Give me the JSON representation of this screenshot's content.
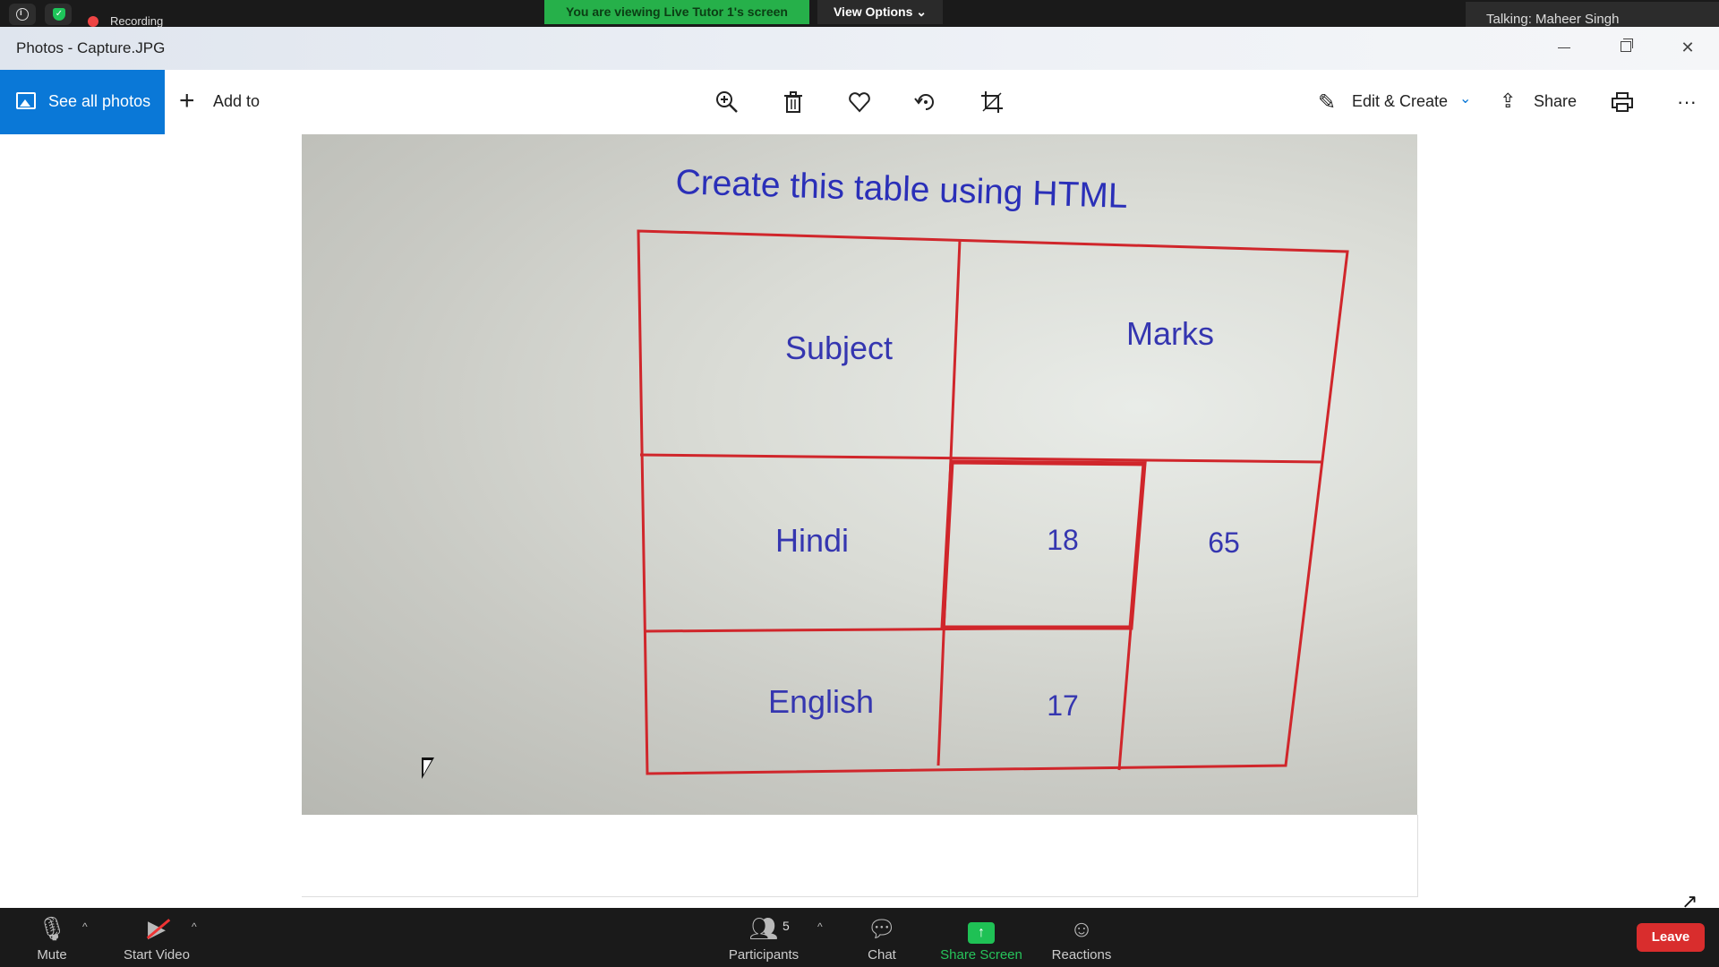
{
  "zoom_top": {
    "recording_label": "Recording",
    "viewing_banner": "You are viewing Live Tutor 1's screen",
    "view_options_label": "View Options ⌄",
    "talking": "Talking: Maheer Singh",
    "colors": {
      "banner": "#26b04a",
      "recording": "#e44444"
    }
  },
  "window": {
    "title": "Photos - Capture.JPG"
  },
  "toolbar": {
    "see_all_photos": "See all photos",
    "add_to": "Add to",
    "edit_create": "Edit & Create",
    "share": "Share",
    "icons": [
      "zoom-in-icon",
      "delete-icon",
      "heart-icon",
      "rotate-icon",
      "crop-icon",
      "print-icon",
      "more-icon"
    ],
    "accent": "#0a78d7"
  },
  "photo": {
    "heading": "Create this table using HTML",
    "table": {
      "subject": "Subject",
      "marks": "Marks",
      "hindi": "Hindi",
      "hindi_mark": "18",
      "total": "65",
      "english": "English",
      "english_mark": "17"
    }
  },
  "zoom_bottom": {
    "mute": "Mute",
    "start_video": "Start Video",
    "participants": "Participants",
    "participants_count": "5",
    "chat": "Chat",
    "share_screen": "Share Screen",
    "reactions": "Reactions",
    "leave": "Leave",
    "colors": {
      "share": "#1fc155",
      "leave": "#d92d2d"
    }
  }
}
